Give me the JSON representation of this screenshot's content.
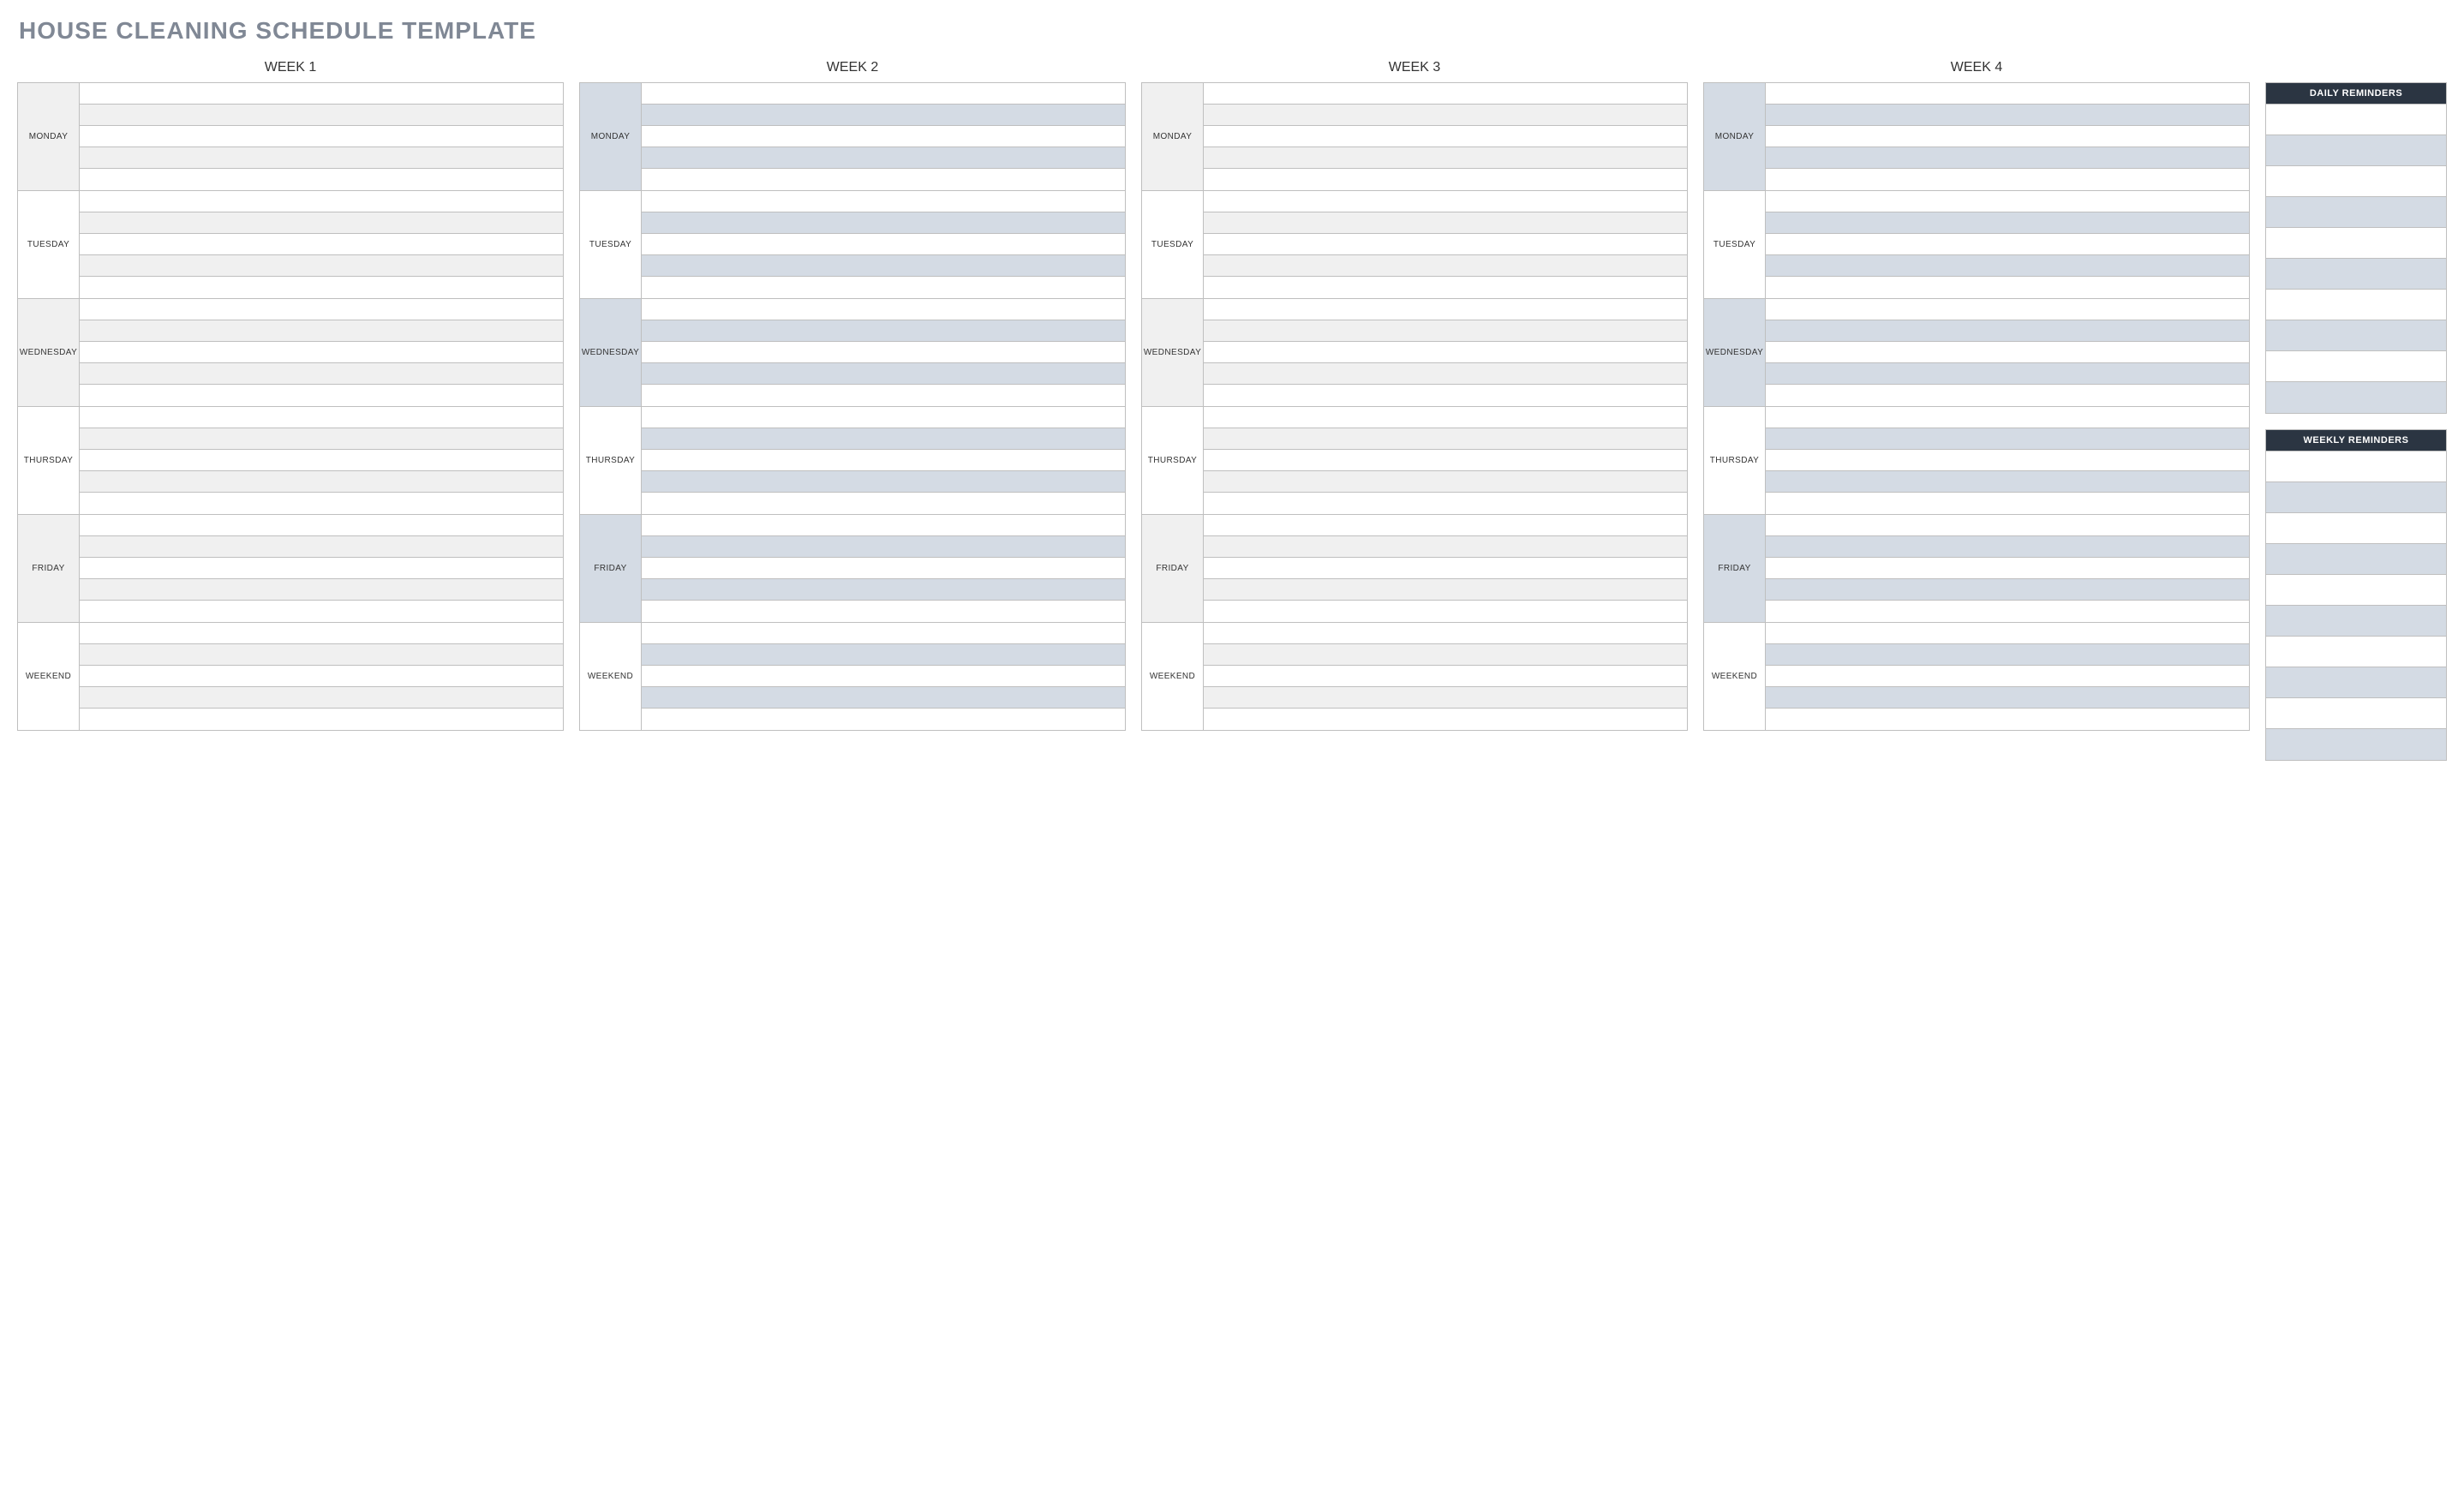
{
  "title": "HOUSE CLEANING SCHEDULE TEMPLATE",
  "weeks": [
    {
      "header": "WEEK 1",
      "scheme": "grey"
    },
    {
      "header": "WEEK 2",
      "scheme": "blue"
    },
    {
      "header": "WEEK 3",
      "scheme": "grey"
    },
    {
      "header": "WEEK 4",
      "scheme": "blue"
    }
  ],
  "days": [
    "MONDAY",
    "TUESDAY",
    "WEDNESDAY",
    "THURSDAY",
    "FRIDAY",
    "WEEKEND"
  ],
  "rows_per_day": 5,
  "daily_reminders": {
    "header": "DAILY REMINDERS",
    "rows": 10
  },
  "weekly_reminders": {
    "header": "WEEKLY REMINDERS",
    "rows": 10
  }
}
